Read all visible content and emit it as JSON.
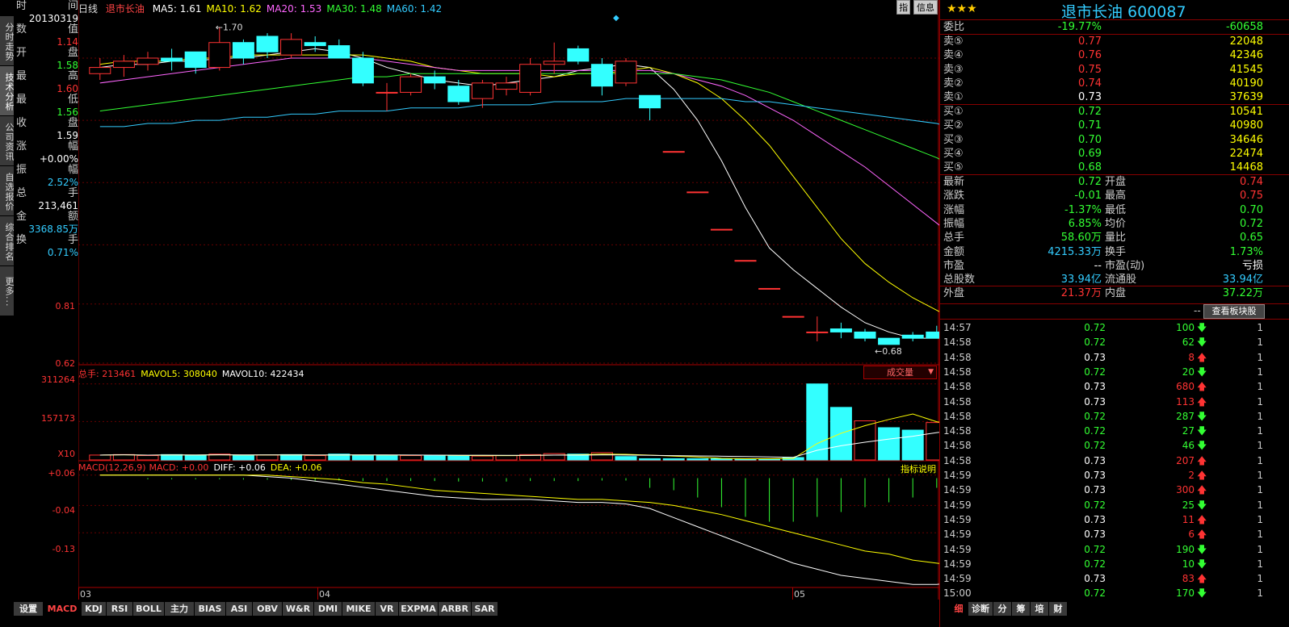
{
  "side_tabs": [
    "分时走势",
    "技术分析",
    "公司资讯",
    "自选报价",
    "综合排名",
    "更多..."
  ],
  "info_panel": {
    "rows": [
      {
        "l": "时",
        "r": "间"
      },
      {
        "l": "数",
        "r": "值"
      },
      {
        "l": "开",
        "r": "盘"
      },
      {
        "l": "最",
        "r": "高"
      },
      {
        "l": "最",
        "r": "低"
      },
      {
        "l": "收",
        "r": "盘"
      },
      {
        "l": "涨",
        "r": "幅"
      },
      {
        "l": "振",
        "r": "幅"
      },
      {
        "l": "总",
        "r": "手"
      },
      {
        "l": "金",
        "r": "额"
      },
      {
        "l": "换",
        "r": "手"
      }
    ],
    "values": {
      "date": "20130319",
      "open": "1.14",
      "high": "1.58",
      "low": "1.60",
      "close": "1.56",
      "change": "1.59",
      "pct": "+0.00%",
      "amplitude": "2.52%",
      "volume": "213,461",
      "amount": "3368.85万",
      "turnover": "0.71%"
    }
  },
  "header": {
    "period": "日线",
    "name": "退市长油",
    "ma": [
      {
        "label": "MA5: 1.61",
        "color": "#ffffff"
      },
      {
        "label": "MA10: 1.62",
        "color": "#ffff00"
      },
      {
        "label": "MA20: 1.53",
        "color": "#ff66ff"
      },
      {
        "label": "MA30: 1.48",
        "color": "#33ff33"
      },
      {
        "label": "MA60: 1.42",
        "color": "#33ccff"
      }
    ],
    "btn_zhi": "指",
    "btn_info": "信息"
  },
  "price_axis": [
    "0.81",
    "0.62"
  ],
  "annotations": {
    "high": "1.70",
    "low": "0.68"
  },
  "volume_panel": {
    "label_total": "总手: 213461",
    "label_mavol5": "MAVOL5: 308040",
    "label_mavol10": "MAVOL10: 422434",
    "axis": [
      "311264",
      "157173",
      "X10"
    ],
    "dropdown": "成交量"
  },
  "macd_panel": {
    "title": "MACD(12,26,9)",
    "macd": "MACD: +0.00",
    "diff": "DIFF: +0.06",
    "dea": "DEA: +0.06",
    "axis": [
      "+0.06",
      "-0.04",
      "-0.13"
    ],
    "help": "指标说明"
  },
  "x_axis": [
    "03",
    "04",
    "05"
  ],
  "chart_data": {
    "type": "candlestick",
    "bars": [
      {
        "o": 1.55,
        "h": 1.6,
        "l": 1.53,
        "c": 1.57
      },
      {
        "o": 1.57,
        "h": 1.61,
        "l": 1.54,
        "c": 1.59
      },
      {
        "o": 1.58,
        "h": 1.62,
        "l": 1.56,
        "c": 1.6
      },
      {
        "o": 1.6,
        "h": 1.63,
        "l": 1.56,
        "c": 1.59
      },
      {
        "o": 1.62,
        "h": 1.61,
        "l": 1.55,
        "c": 1.57
      },
      {
        "o": 1.57,
        "h": 1.7,
        "l": 1.56,
        "c": 1.65
      },
      {
        "o": 1.65,
        "h": 1.66,
        "l": 1.58,
        "c": 1.6
      },
      {
        "o": 1.67,
        "h": 1.68,
        "l": 1.6,
        "c": 1.62
      },
      {
        "o": 1.61,
        "h": 1.68,
        "l": 1.6,
        "c": 1.66
      },
      {
        "o": 1.65,
        "h": 1.67,
        "l": 1.62,
        "c": 1.64
      },
      {
        "o": 1.64,
        "h": 1.66,
        "l": 1.61,
        "c": 1.6
      },
      {
        "o": 1.6,
        "h": 1.62,
        "l": 1.51,
        "c": 1.52
      },
      {
        "o": 1.49,
        "h": 1.52,
        "l": 1.43,
        "c": 1.49
      },
      {
        "o": 1.49,
        "h": 1.55,
        "l": 1.48,
        "c": 1.54
      },
      {
        "o": 1.54,
        "h": 1.56,
        "l": 1.5,
        "c": 1.52
      },
      {
        "o": 1.51,
        "h": 1.53,
        "l": 1.45,
        "c": 1.46
      },
      {
        "o": 1.47,
        "h": 1.53,
        "l": 1.44,
        "c": 1.52
      },
      {
        "o": 1.5,
        "h": 1.54,
        "l": 1.48,
        "c": 1.52
      },
      {
        "o": 1.49,
        "h": 1.6,
        "l": 1.48,
        "c": 1.58
      },
      {
        "o": 1.58,
        "h": 1.65,
        "l": 1.55,
        "c": 1.59
      },
      {
        "o": 1.63,
        "h": 1.64,
        "l": 1.58,
        "c": 1.59
      },
      {
        "o": 1.58,
        "h": 1.6,
        "l": 1.48,
        "c": 1.51
      },
      {
        "o": 1.52,
        "h": 1.6,
        "l": 1.51,
        "c": 1.59
      },
      {
        "o": 1.48,
        "h": 1.48,
        "l": 1.4,
        "c": 1.44
      },
      {
        "o": 1.3,
        "h": 1.3,
        "l": 1.3,
        "c": 1.3
      },
      {
        "o": 1.17,
        "h": 1.17,
        "l": 1.17,
        "c": 1.17
      },
      {
        "o": 1.05,
        "h": 1.05,
        "l": 1.05,
        "c": 1.05
      },
      {
        "o": 0.95,
        "h": 0.95,
        "l": 0.95,
        "c": 0.95
      },
      {
        "o": 0.86,
        "h": 0.86,
        "l": 0.86,
        "c": 0.86
      },
      {
        "o": 0.77,
        "h": 0.77,
        "l": 0.77,
        "c": 0.77
      },
      {
        "o": 0.72,
        "h": 0.77,
        "l": 0.69,
        "c": 0.72
      },
      {
        "o": 0.73,
        "h": 0.75,
        "l": 0.7,
        "c": 0.72
      },
      {
        "o": 0.72,
        "h": 0.73,
        "l": 0.69,
        "c": 0.7
      },
      {
        "o": 0.7,
        "h": 0.7,
        "l": 0.68,
        "c": 0.68
      },
      {
        "o": 0.71,
        "h": 0.72,
        "l": 0.69,
        "c": 0.7
      },
      {
        "o": 0.72,
        "h": 0.74,
        "l": 0.7,
        "c": 0.7
      },
      {
        "o": 0.73,
        "h": 0.74,
        "l": 0.7,
        "c": 0.71
      }
    ],
    "ma": [
      {
        "name": "MA5",
        "color": "#ffffff",
        "values": [
          1.57,
          1.58,
          1.58,
          1.59,
          1.59,
          1.6,
          1.6,
          1.61,
          1.62,
          1.63,
          1.62,
          1.6,
          1.57,
          1.55,
          1.53,
          1.52,
          1.51,
          1.52,
          1.53,
          1.54,
          1.56,
          1.57,
          1.58,
          1.57,
          1.5,
          1.4,
          1.27,
          1.12,
          0.99,
          0.92,
          0.86,
          0.8,
          0.75,
          0.72,
          0.7,
          0.7,
          0.7
        ]
      },
      {
        "name": "MA10",
        "color": "#ffff00",
        "values": [
          1.58,
          1.59,
          1.59,
          1.59,
          1.6,
          1.6,
          1.61,
          1.61,
          1.61,
          1.61,
          1.61,
          1.61,
          1.6,
          1.59,
          1.57,
          1.56,
          1.55,
          1.55,
          1.55,
          1.54,
          1.55,
          1.55,
          1.56,
          1.57,
          1.55,
          1.52,
          1.47,
          1.4,
          1.32,
          1.22,
          1.12,
          1.02,
          0.94,
          0.88,
          0.83,
          0.79,
          0.75
        ]
      },
      {
        "name": "MA20",
        "color": "#ff66ff",
        "values": [
          1.52,
          1.53,
          1.54,
          1.55,
          1.56,
          1.57,
          1.58,
          1.59,
          1.6,
          1.6,
          1.6,
          1.6,
          1.59,
          1.58,
          1.57,
          1.56,
          1.56,
          1.56,
          1.56,
          1.56,
          1.56,
          1.56,
          1.56,
          1.56,
          1.55,
          1.53,
          1.51,
          1.48,
          1.44,
          1.4,
          1.35,
          1.3,
          1.25,
          1.19,
          1.13,
          1.07,
          1.01
        ]
      },
      {
        "name": "MA30",
        "color": "#33ff33",
        "values": [
          1.43,
          1.44,
          1.45,
          1.46,
          1.47,
          1.48,
          1.49,
          1.5,
          1.51,
          1.52,
          1.53,
          1.54,
          1.54,
          1.55,
          1.55,
          1.55,
          1.55,
          1.55,
          1.55,
          1.55,
          1.55,
          1.55,
          1.55,
          1.55,
          1.55,
          1.54,
          1.53,
          1.51,
          1.49,
          1.46,
          1.43,
          1.4,
          1.37,
          1.34,
          1.31,
          1.28,
          1.24
        ]
      },
      {
        "name": "MA60",
        "color": "#33ccff",
        "values": [
          1.38,
          1.38,
          1.39,
          1.39,
          1.4,
          1.4,
          1.41,
          1.41,
          1.42,
          1.42,
          1.43,
          1.43,
          1.43,
          1.44,
          1.44,
          1.44,
          1.45,
          1.45,
          1.45,
          1.46,
          1.46,
          1.46,
          1.47,
          1.47,
          1.47,
          1.47,
          1.47,
          1.46,
          1.46,
          1.45,
          1.44,
          1.43,
          1.42,
          1.41,
          1.4,
          1.39,
          1.37
        ]
      }
    ],
    "volume": [
      20,
      22,
      18,
      22,
      20,
      24,
      18,
      20,
      22,
      18,
      24,
      20,
      18,
      18,
      18,
      18,
      16,
      18,
      22,
      26,
      24,
      30,
      14,
      5,
      5,
      5,
      5,
      5,
      5,
      10,
      311,
      215,
      160,
      132,
      122,
      153,
      130
    ],
    "vol_up": [
      1,
      1,
      1,
      0,
      0,
      1,
      0,
      1,
      0,
      1,
      0,
      0,
      0,
      1,
      0,
      0,
      1,
      1,
      1,
      1,
      0,
      1,
      0,
      0,
      0,
      0,
      0,
      0,
      0,
      0,
      0,
      0,
      1,
      0,
      0,
      1,
      1
    ],
    "macd_bars": [
      0.0,
      0.0,
      -0.005,
      -0.005,
      -0.005,
      -0.005,
      -0.006,
      -0.006,
      -0.008,
      -0.01,
      -0.01,
      -0.012,
      -0.012,
      -0.012,
      -0.012,
      -0.014,
      -0.014,
      -0.014,
      -0.012,
      -0.012,
      -0.012,
      -0.01,
      -0.01,
      -0.04,
      -0.05,
      -0.08,
      -0.12,
      -0.16,
      -0.18,
      -0.18,
      -0.16,
      -0.14,
      -0.12,
      -0.1,
      -0.08,
      -0.04,
      -0.02
    ],
    "diff": [
      0.06,
      0.06,
      0.06,
      0.06,
      0.06,
      0.06,
      0.06,
      0.055,
      0.05,
      0.04,
      0.03,
      0.02,
      0.01,
      0.0,
      -0.01,
      -0.015,
      -0.02,
      -0.02,
      -0.02,
      -0.025,
      -0.03,
      -0.03,
      -0.035,
      -0.05,
      -0.08,
      -0.11,
      -0.14,
      -0.17,
      -0.2,
      -0.23,
      -0.25,
      -0.27,
      -0.28,
      -0.29,
      -0.3,
      -0.3,
      -0.29
    ],
    "dea": [
      0.06,
      0.06,
      0.06,
      0.06,
      0.06,
      0.06,
      0.06,
      0.06,
      0.055,
      0.05,
      0.045,
      0.035,
      0.03,
      0.02,
      0.01,
      0.005,
      0.0,
      -0.005,
      -0.01,
      -0.015,
      -0.02,
      -0.02,
      -0.025,
      -0.03,
      -0.04,
      -0.055,
      -0.07,
      -0.09,
      -0.11,
      -0.13,
      -0.15,
      -0.17,
      -0.19,
      -0.2,
      -0.22,
      -0.23,
      -0.24
    ],
    "price_range": [
      0.62,
      1.74
    ],
    "vol_max": 330,
    "macd_range": [
      -0.31,
      0.07
    ]
  },
  "right_panel": {
    "title": "退市长油 600087",
    "stars": "★★★",
    "wei_bi": {
      "label": "委比",
      "v1": "-19.77%",
      "v2": "-60658"
    },
    "sells": [
      {
        "label": "卖⑤",
        "price": "0.77",
        "vol": "22048"
      },
      {
        "label": "卖④",
        "price": "0.76",
        "vol": "42346"
      },
      {
        "label": "卖③",
        "price": "0.75",
        "vol": "41545"
      },
      {
        "label": "卖②",
        "price": "0.74",
        "vol": "40190"
      },
      {
        "label": "卖①",
        "price": "0.73",
        "vol": "37639"
      }
    ],
    "buys": [
      {
        "label": "买①",
        "price": "0.72",
        "vol": "10541"
      },
      {
        "label": "买②",
        "price": "0.71",
        "vol": "40980"
      },
      {
        "label": "买③",
        "price": "0.70",
        "vol": "34646"
      },
      {
        "label": "买④",
        "price": "0.69",
        "vol": "22474"
      },
      {
        "label": "买⑤",
        "price": "0.68",
        "vol": "14468"
      }
    ],
    "stats": [
      {
        "l1": "最新",
        "v1": "0.72",
        "c1": "green",
        "l2": "开盘",
        "v2": "0.74",
        "c2": "red"
      },
      {
        "l1": "涨跌",
        "v1": "-0.01",
        "c1": "green",
        "l2": "最高",
        "v2": "0.75",
        "c2": "red"
      },
      {
        "l1": "涨幅",
        "v1": "-1.37%",
        "c1": "green",
        "l2": "最低",
        "v2": "0.70",
        "c2": "green"
      },
      {
        "l1": "振幅",
        "v1": "6.85%",
        "c1": "green",
        "l2": "均价",
        "v2": "0.72",
        "c2": "green"
      },
      {
        "l1": "总手",
        "v1": "58.60万",
        "c1": "green",
        "l2": "量比",
        "v2": "0.65",
        "c2": "green"
      },
      {
        "l1": "金额",
        "v1": "4215.33万",
        "c1": "cyan",
        "l2": "换手",
        "v2": "1.73%",
        "c2": "green"
      },
      {
        "l1": "市盈",
        "v1": "--",
        "c1": "white",
        "l2": "市盈(动)",
        "v2": "亏损",
        "c2": "white"
      },
      {
        "l1": "总股数",
        "v1": "33.94亿",
        "c1": "cyan",
        "l2": "流通股",
        "v2": "33.94亿",
        "c2": "cyan"
      },
      {
        "l1": "外盘",
        "v1": "21.37万",
        "c1": "red",
        "l2": "内盘",
        "v2": "37.22万",
        "c2": "green"
      }
    ],
    "block_btn": "查看板块股",
    "dash": "--",
    "ticks": [
      {
        "t": "14:57",
        "p": "0.72",
        "pc": "green",
        "q": "100",
        "up": false,
        "n": "1"
      },
      {
        "t": "14:58",
        "p": "0.72",
        "pc": "green",
        "q": "62",
        "up": false,
        "n": "1"
      },
      {
        "t": "14:58",
        "p": "0.73",
        "pc": "white",
        "q": "8",
        "up": true,
        "n": "1"
      },
      {
        "t": "14:58",
        "p": "0.72",
        "pc": "green",
        "q": "20",
        "up": false,
        "n": "1"
      },
      {
        "t": "14:58",
        "p": "0.73",
        "pc": "white",
        "q": "680",
        "up": true,
        "n": "1"
      },
      {
        "t": "14:58",
        "p": "0.73",
        "pc": "white",
        "q": "113",
        "up": true,
        "n": "1"
      },
      {
        "t": "14:58",
        "p": "0.72",
        "pc": "green",
        "q": "287",
        "up": false,
        "n": "1"
      },
      {
        "t": "14:58",
        "p": "0.72",
        "pc": "green",
        "q": "27",
        "up": false,
        "n": "1"
      },
      {
        "t": "14:58",
        "p": "0.72",
        "pc": "green",
        "q": "46",
        "up": false,
        "n": "1"
      },
      {
        "t": "14:58",
        "p": "0.73",
        "pc": "white",
        "q": "207",
        "up": true,
        "n": "1"
      },
      {
        "t": "14:59",
        "p": "0.73",
        "pc": "white",
        "q": "2",
        "up": true,
        "n": "1"
      },
      {
        "t": "14:59",
        "p": "0.73",
        "pc": "white",
        "q": "300",
        "up": true,
        "n": "1"
      },
      {
        "t": "14:59",
        "p": "0.72",
        "pc": "green",
        "q": "25",
        "up": false,
        "n": "1"
      },
      {
        "t": "14:59",
        "p": "0.73",
        "pc": "white",
        "q": "11",
        "up": true,
        "n": "1"
      },
      {
        "t": "14:59",
        "p": "0.73",
        "pc": "white",
        "q": "6",
        "up": true,
        "n": "1"
      },
      {
        "t": "14:59",
        "p": "0.72",
        "pc": "green",
        "q": "190",
        "up": false,
        "n": "1"
      },
      {
        "t": "14:59",
        "p": "0.72",
        "pc": "green",
        "q": "10",
        "up": false,
        "n": "1"
      },
      {
        "t": "14:59",
        "p": "0.73",
        "pc": "white",
        "q": "83",
        "up": true,
        "n": "1"
      },
      {
        "t": "15:00",
        "p": "0.72",
        "pc": "green",
        "q": "170",
        "up": false,
        "n": "1"
      }
    ],
    "bottom_tabs": [
      "细",
      "诊断",
      "分",
      "筹",
      "培",
      "财"
    ]
  },
  "bottom_tabs": [
    "设置",
    "MACD",
    "KDJ",
    "RSI",
    "BOLL",
    "主力",
    "BIAS",
    "ASI",
    "OBV",
    "W&R",
    "DMI",
    "MIKE",
    "VR",
    "EXPMA",
    "ARBR",
    "SAR"
  ]
}
